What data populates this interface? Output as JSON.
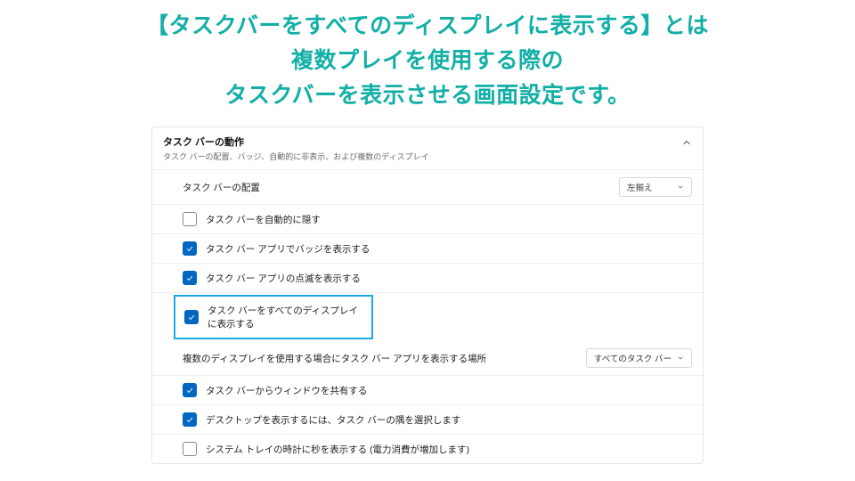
{
  "headline": {
    "l1": "【タスクバーをすべてのディスプレイに表示する】とは",
    "l2": "複数プレイを使用する際の",
    "l3": "タスクバーを表示させる画面設定です。"
  },
  "panel": {
    "title": "タスク バーの動作",
    "subtitle": "タスク バーの配置、バッジ、自動的に非表示、および複数のディスプレイ",
    "alignment": {
      "label": "タスク バーの配置",
      "select_value": "左揃え"
    },
    "options": {
      "autohide": {
        "label": "タスク バーを自動的に隠す",
        "checked": false
      },
      "badges": {
        "label": "タスク バー アプリでバッジを表示する",
        "checked": true
      },
      "flash": {
        "label": "タスク バー アプリの点滅を表示する",
        "checked": true
      },
      "all_disp": {
        "label": "タスク バーをすべてのディスプレイに表示する",
        "checked": true
      },
      "share_win": {
        "label": "タスク バーからウィンドウを共有する",
        "checked": true
      },
      "desktop": {
        "label": "デスクトップを表示するには、タスク バーの隅を選択します",
        "checked": true
      },
      "clock_sec": {
        "label": "システム トレイの時計に秒を表示する (電力消費が増加します)",
        "checked": false
      }
    },
    "multi": {
      "label": "複数のディスプレイを使用する場合にタスク バー アプリを表示する場所",
      "select_value": "すべてのタスク バー"
    }
  }
}
